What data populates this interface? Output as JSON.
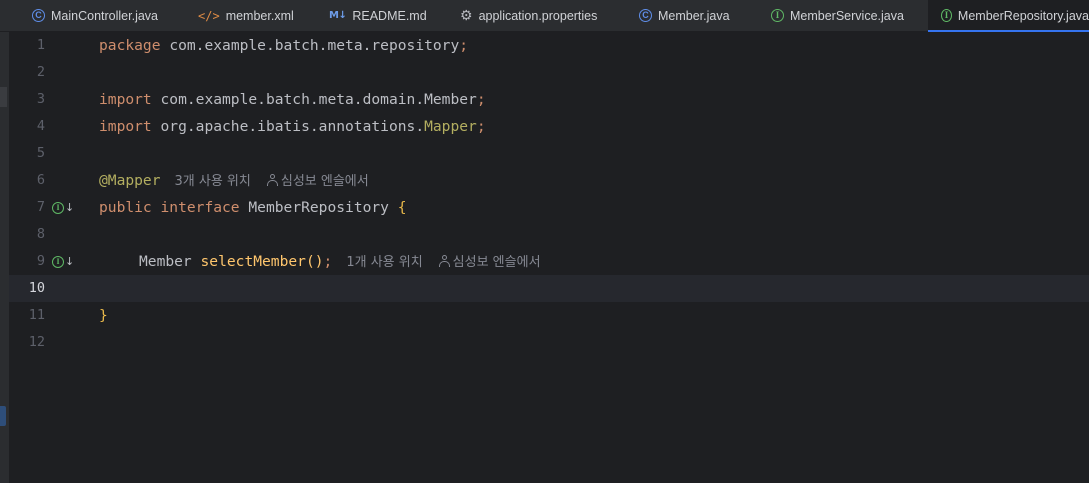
{
  "tabs": [
    {
      "label": "MainController.java",
      "icon": "class-icon"
    },
    {
      "label": "member.xml",
      "icon": "xml-icon"
    },
    {
      "label": "README.md",
      "icon": "markdown-icon"
    },
    {
      "label": "application.properties",
      "icon": "gear-icon"
    },
    {
      "label": "Member.java",
      "icon": "class-icon"
    },
    {
      "label": "MemberService.java",
      "icon": "interface-icon"
    },
    {
      "label": "MemberRepository.java",
      "icon": "interface-icon",
      "active": true
    }
  ],
  "editor": {
    "current_line": 10,
    "line_numbers": [
      "1",
      "2",
      "3",
      "4",
      "5",
      "6",
      "7",
      "8",
      "9",
      "10",
      "11",
      "12"
    ],
    "code": {
      "l1_kw": "package",
      "l1_pkg": "com.example.batch.meta.repository",
      "l1_semi": ";",
      "l3_kw": "import",
      "l3_path": "com.example.batch.meta.domain.Member",
      "l3_semi": ";",
      "l4_kw": "import",
      "l4_path": "org.apache.ibatis.annotations.",
      "l4_cls": "Mapper",
      "l4_semi": ";",
      "l6_ann": "@Mapper",
      "l6_usage": "3개 사용 위치",
      "l6_author": "심성보 엔슬에서",
      "l7_kw1": "public",
      "l7_kw2": "interface",
      "l7_name": "MemberRepository",
      "l7_brace": "{",
      "l9_type": "Member",
      "l9_method": "selectMember",
      "l9_parens": "()",
      "l9_semi": ";",
      "l9_usage": "1개 사용 위치",
      "l9_author": "심성보 엔슬에서",
      "l11_brace": "}"
    }
  },
  "colors": {
    "background": "#1e1f22",
    "keyword": "#cf8e6d",
    "annotation": "#b3ae60",
    "method": "#ffc66d",
    "accent": "#3574f0"
  }
}
